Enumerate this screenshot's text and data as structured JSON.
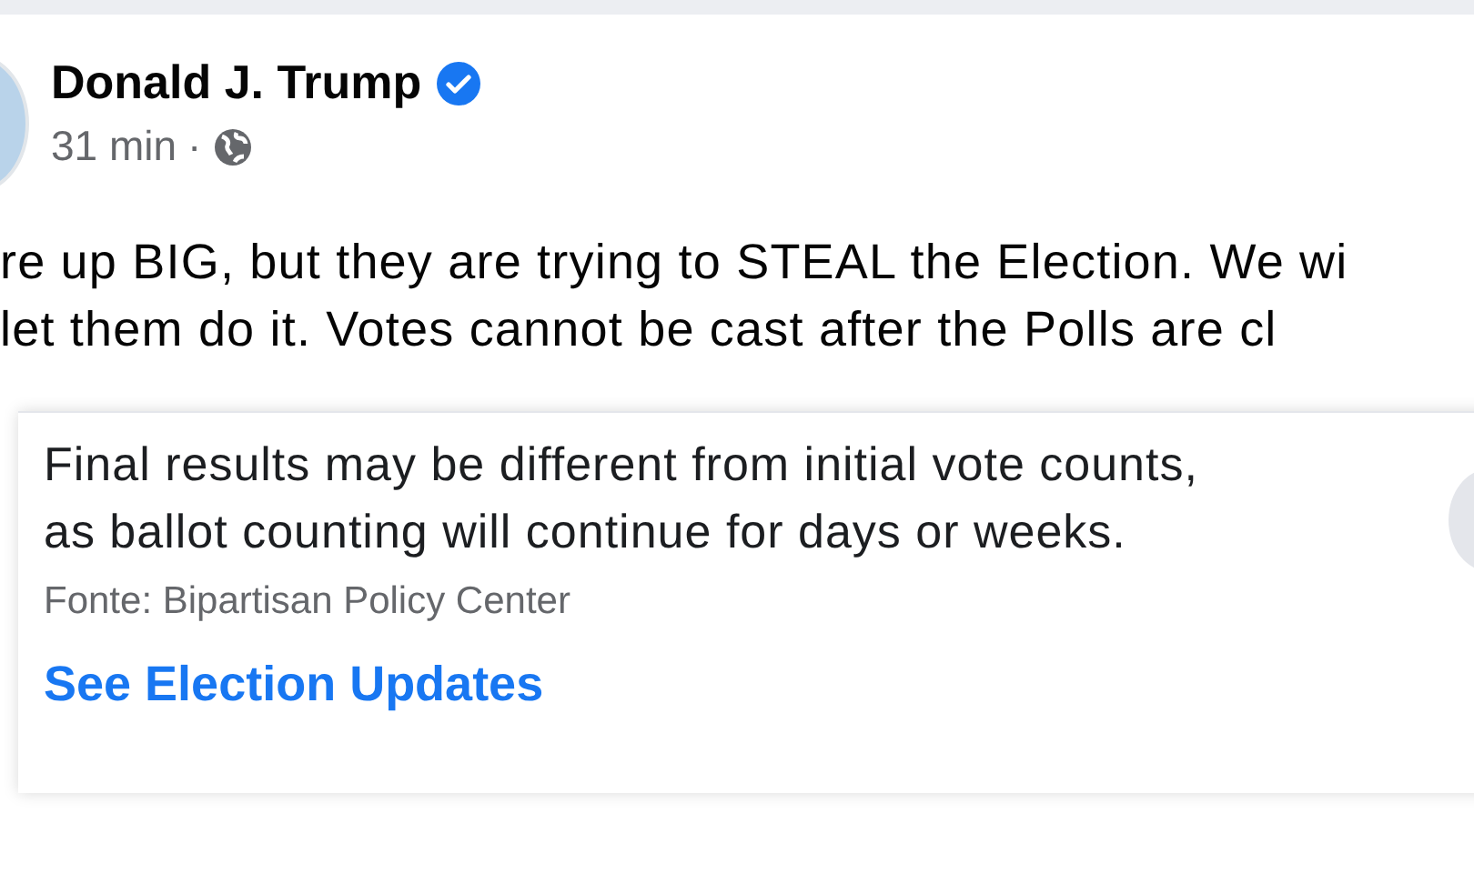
{
  "post": {
    "author": "Donald J. Trump",
    "verified": true,
    "time": "31 min",
    "separator": "·",
    "audience_public": true,
    "text_lines": [
      "re up BIG, but they are trying to STEAL the Election. We wi",
      "let them do it. Votes cannot be cast after the Polls are cl"
    ]
  },
  "notice": {
    "lines": [
      "Final results may be different from initial vote counts,",
      "as ballot counting will continue for days or weeks."
    ],
    "source": "Fonte: Bipartisan Policy Center",
    "link": "See Election Updates"
  }
}
